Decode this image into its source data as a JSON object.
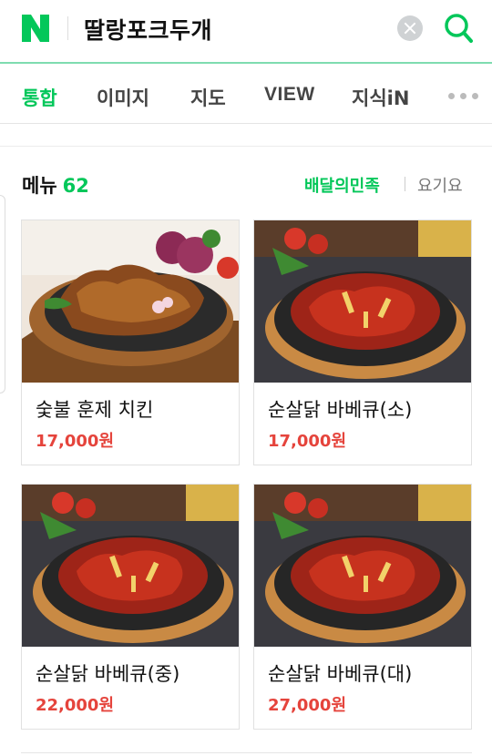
{
  "header": {
    "logo_letter": "N",
    "brand_color": "#03c75a",
    "query": "딸랑포크두개",
    "clear_icon": "clear-icon",
    "search_icon": "search-icon"
  },
  "tabs": [
    {
      "label": "통합",
      "active": true
    },
    {
      "label": "이미지",
      "active": false
    },
    {
      "label": "지도",
      "active": false
    },
    {
      "label": "VIEW",
      "active": false
    },
    {
      "label": "지식iN",
      "active": false
    }
  ],
  "menu_section": {
    "title": "메뉴",
    "count": "62",
    "source_primary": "배달의민족",
    "source_secondary": "요기요"
  },
  "items": [
    {
      "name": "숯불 훈제 치킨",
      "price": "17,000원"
    },
    {
      "name": "순살닭 바베큐(소)",
      "price": "17,000원"
    },
    {
      "name": "순살닭 바베큐(중)",
      "price": "22,000원"
    },
    {
      "name": "순살닭 바베큐(대)",
      "price": "27,000원"
    }
  ],
  "colors": {
    "accent": "#03c75a",
    "price": "#e5443c"
  }
}
